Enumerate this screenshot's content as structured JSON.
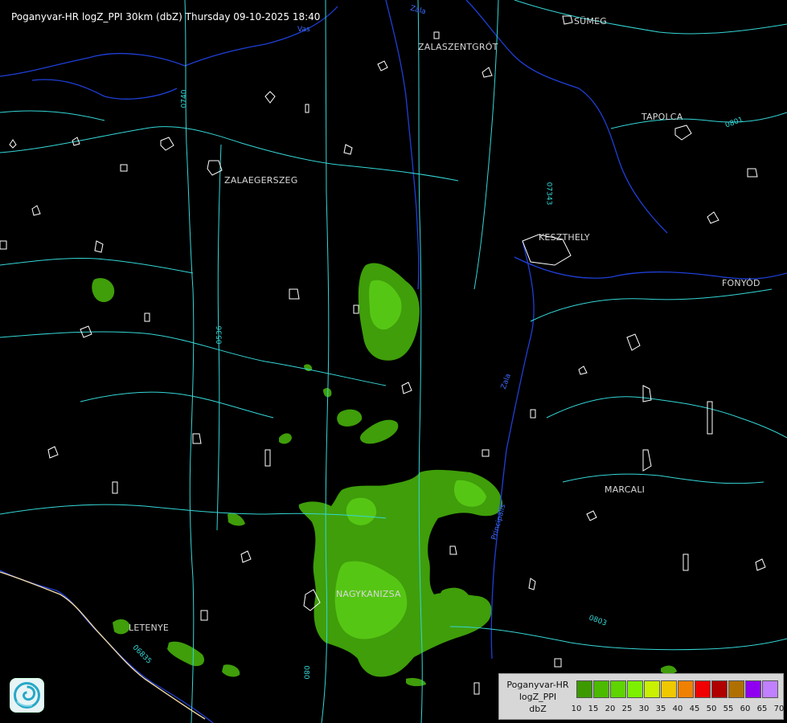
{
  "header": {
    "title": "Poganyvar-HR logZ_PPI 30km (dbZ) Thursday 09-10-2025 18:40"
  },
  "map": {
    "towns": [
      {
        "id": "sumeg",
        "name": "SÜMEG"
      },
      {
        "id": "zalaszentgrot",
        "name": "ZALASZENTGRÓT"
      },
      {
        "id": "tapolca",
        "name": "TAPOLCA"
      },
      {
        "id": "zalaegerszeg",
        "name": "ZALAEGERSZEG"
      },
      {
        "id": "keszthely",
        "name": "KESZTHELY"
      },
      {
        "id": "fonyod",
        "name": "FONYÓD"
      },
      {
        "id": "marcali",
        "name": "MARCALI"
      },
      {
        "id": "nagykanizsa",
        "name": "NAGYKANIZSA"
      },
      {
        "id": "letenye",
        "name": "LETENYE"
      }
    ],
    "road_labels": [
      "0740",
      "07343",
      "0536",
      "0803",
      "06835",
      "080",
      "0801"
    ],
    "river_labels": [
      "Zala",
      "Zala",
      "Vas",
      "Principális"
    ]
  },
  "legend": {
    "title_lines": [
      "Poganyvar-HR",
      "logZ_PPI",
      "dbZ"
    ],
    "ticks": [
      "10",
      "15",
      "20",
      "25",
      "30",
      "35",
      "40",
      "45",
      "50",
      "55",
      "60",
      "65",
      "70"
    ],
    "colors": [
      "#3c9a00",
      "#4cba00",
      "#5ed400",
      "#7cf000",
      "#c8f000",
      "#f0c800",
      "#f08000",
      "#f00000",
      "#b00000",
      "#b07000",
      "#9000f0",
      "#c080ff",
      "#b8b8ff"
    ]
  },
  "logo": {
    "icon": "radar-swirl-logo-icon"
  }
}
